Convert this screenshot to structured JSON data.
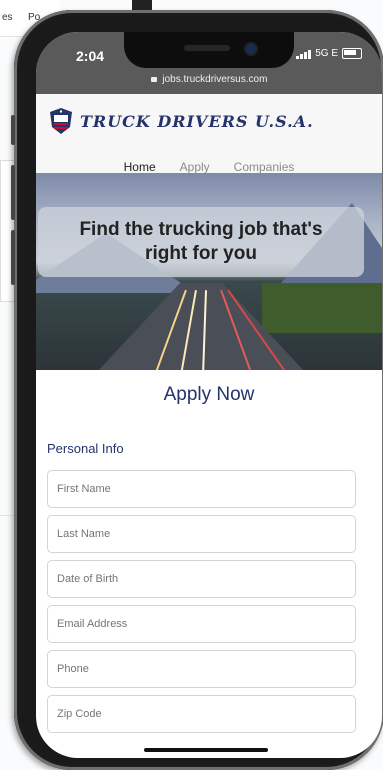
{
  "background_page": {
    "nav_items": [
      "es",
      "Po"
    ]
  },
  "status_bar": {
    "time": "2:04",
    "network": "5G E",
    "url": "jobs.truckdriversus.com"
  },
  "brand": {
    "name": "TRUCK DRIVERS U.S.A."
  },
  "nav": {
    "items": [
      "Home",
      "Apply",
      "Companies"
    ],
    "active": "Home"
  },
  "hero": {
    "title": "Find the trucking job that's right for you"
  },
  "form": {
    "title": "Apply Now",
    "section": "Personal Info",
    "fields": [
      {
        "placeholder": "First Name",
        "value": ""
      },
      {
        "placeholder": "Last Name",
        "value": ""
      },
      {
        "placeholder": "Date of Birth",
        "value": ""
      },
      {
        "placeholder": "Email Address",
        "value": ""
      },
      {
        "placeholder": "Phone",
        "value": ""
      },
      {
        "placeholder": "Zip Code",
        "value": ""
      }
    ]
  },
  "colors": {
    "brand_navy": "#25336b",
    "status_bar": "#5a5a5a",
    "phone_frame": "#1a1a1a"
  },
  "icons": [
    "lock-icon",
    "signal-icon",
    "battery-icon",
    "truck-logo-icon"
  ]
}
